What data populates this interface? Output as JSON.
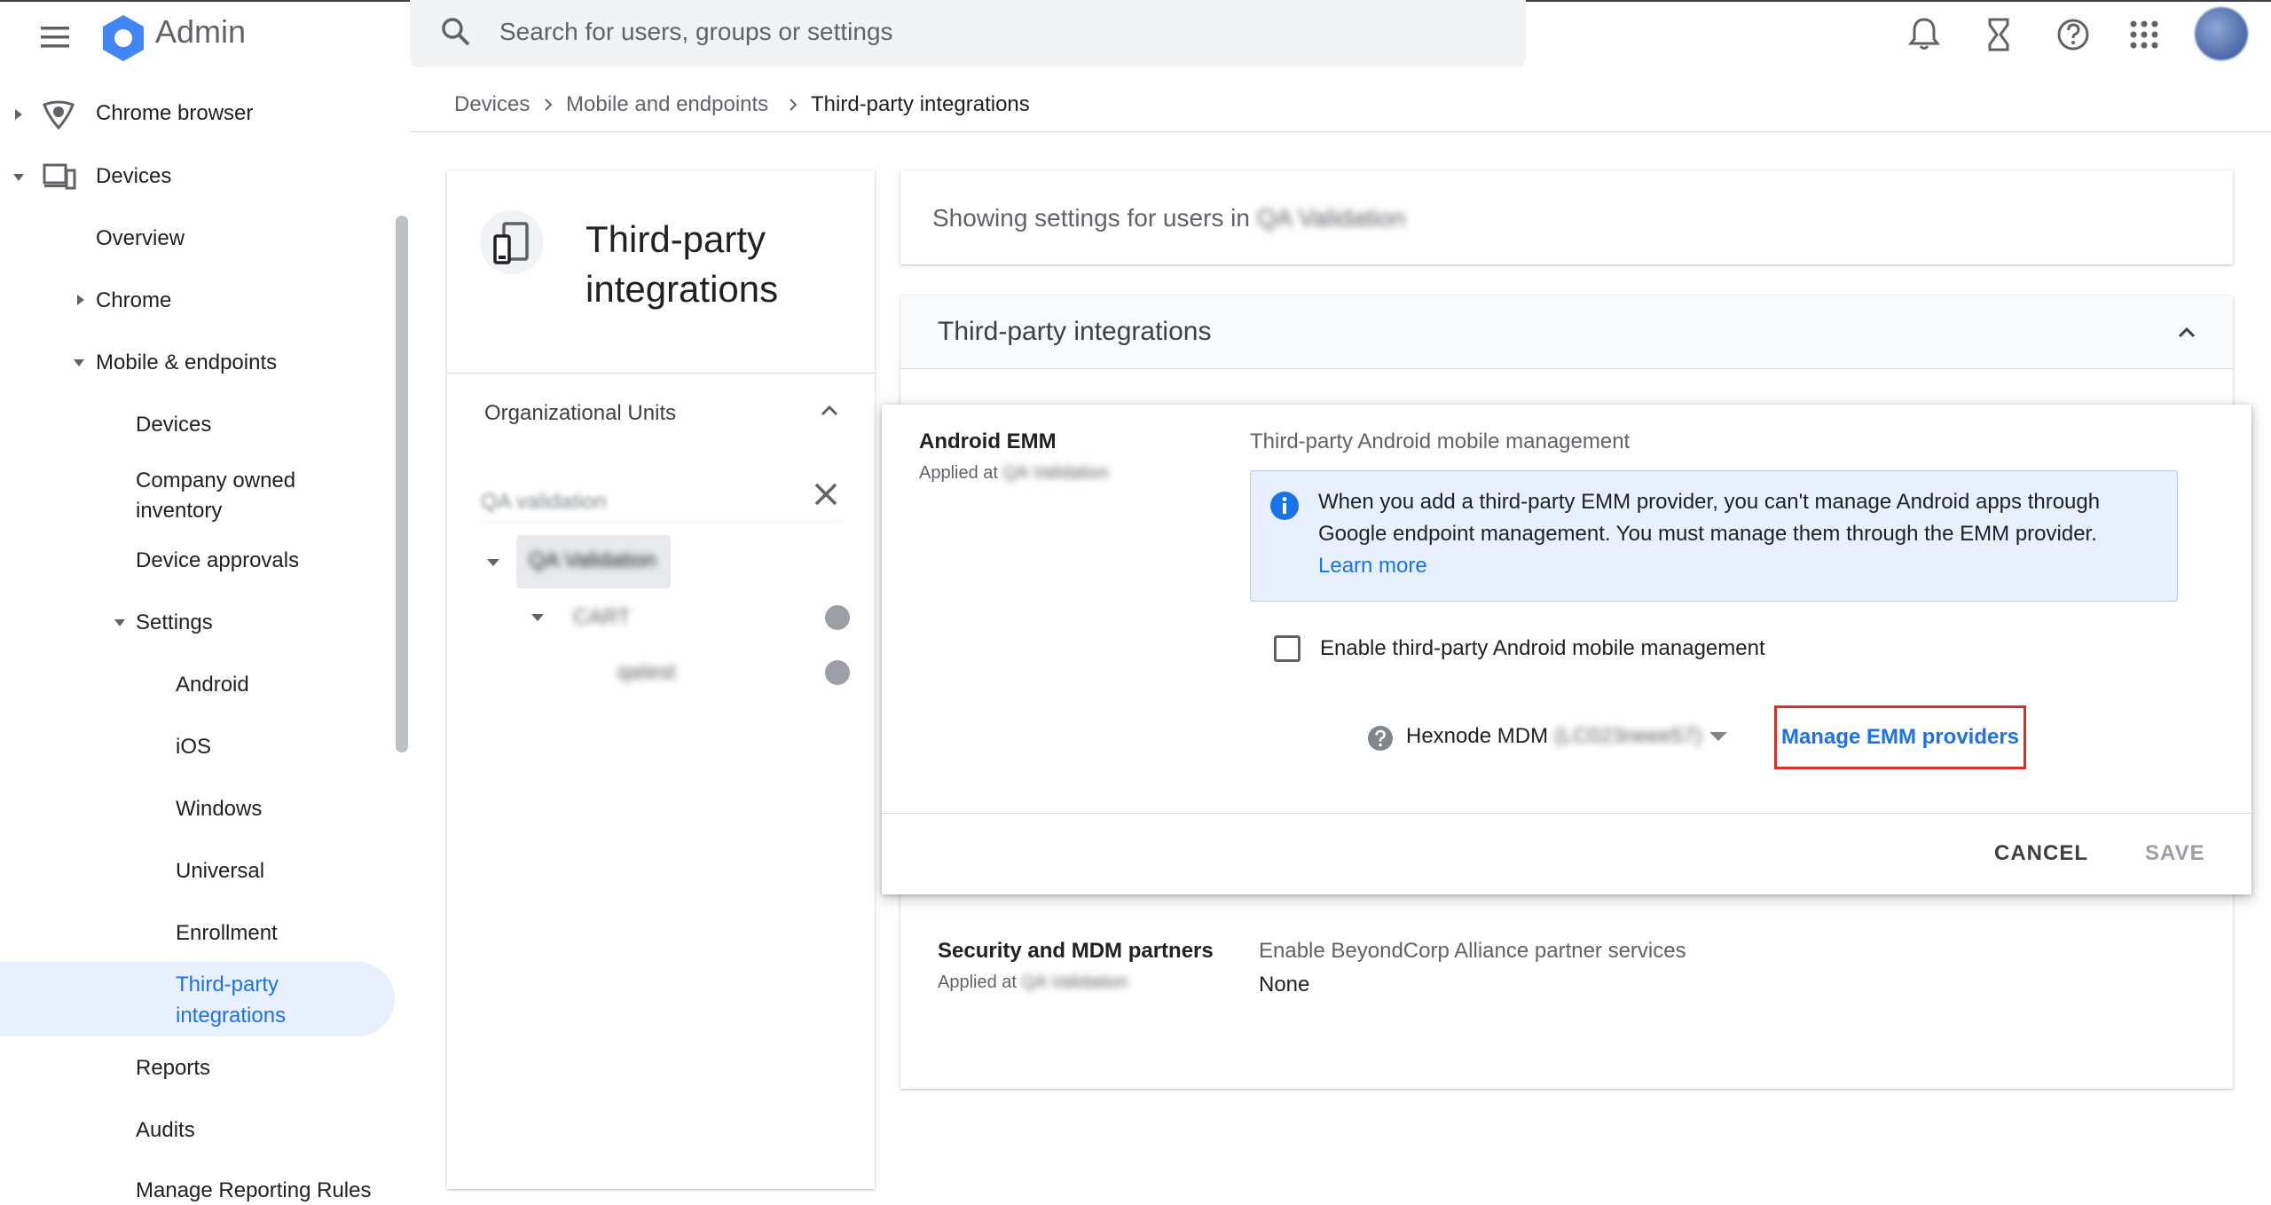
{
  "app": {
    "title": "Admin",
    "search_placeholder": "Search for users, groups or settings"
  },
  "sidebar": {
    "items": [
      {
        "label": "Chrome browser"
      },
      {
        "label": "Devices"
      },
      {
        "label": "Overview"
      },
      {
        "label": "Chrome"
      },
      {
        "label": "Mobile & endpoints"
      },
      {
        "label": "Devices"
      },
      {
        "label": "Company owned inventory"
      },
      {
        "label": "Device approvals"
      },
      {
        "label": "Settings"
      },
      {
        "label": "Android"
      },
      {
        "label": "iOS"
      },
      {
        "label": "Windows"
      },
      {
        "label": "Universal"
      },
      {
        "label": "Enrollment"
      },
      {
        "label": "Third-party integrations"
      },
      {
        "label": "Reports"
      },
      {
        "label": "Audits"
      },
      {
        "label": "Manage Reporting Rules"
      }
    ]
  },
  "breadcrumb": [
    "Devices",
    "Mobile and endpoints",
    "Third-party integrations"
  ],
  "left_panel": {
    "title": "Third-party integrations",
    "ou_section_title": "Organizational Units",
    "ou_filter_value": "QA validation",
    "tree": [
      {
        "label": "QA Validation"
      },
      {
        "label": "CART"
      },
      {
        "label": "qatest"
      }
    ]
  },
  "scope": {
    "label": "Showing settings for users in",
    "org_unit": "QA Validation"
  },
  "section": {
    "title": "Third-party integrations"
  },
  "android_emm": {
    "name": "Android EMM",
    "applied_at_label": "Applied at",
    "applied_at_value": "QA Validation",
    "setting_title": "Third-party Android mobile management",
    "info_text": "When you add a third-party EMM provider, you can't manage Android apps through Google endpoint management. You must manage them through the EMM provider.",
    "learn_more": "Learn more",
    "checkbox_label": "Enable third-party Android mobile management",
    "provider_name": "Hexnode MDM",
    "provider_id": "(LC023neee57)",
    "manage_link": "Manage EMM providers",
    "cancel": "CANCEL",
    "save": "SAVE"
  },
  "security_partners": {
    "name": "Security and MDM partners",
    "applied_at_label": "Applied at",
    "applied_at_value": "QA Validation",
    "setting_title": "Enable BeyondCorp Alliance partner services",
    "value": "None"
  },
  "colors": {
    "accent": "#1a73e8",
    "selected_bg": "#e8f0fe",
    "highlight_border": "#d93025"
  }
}
